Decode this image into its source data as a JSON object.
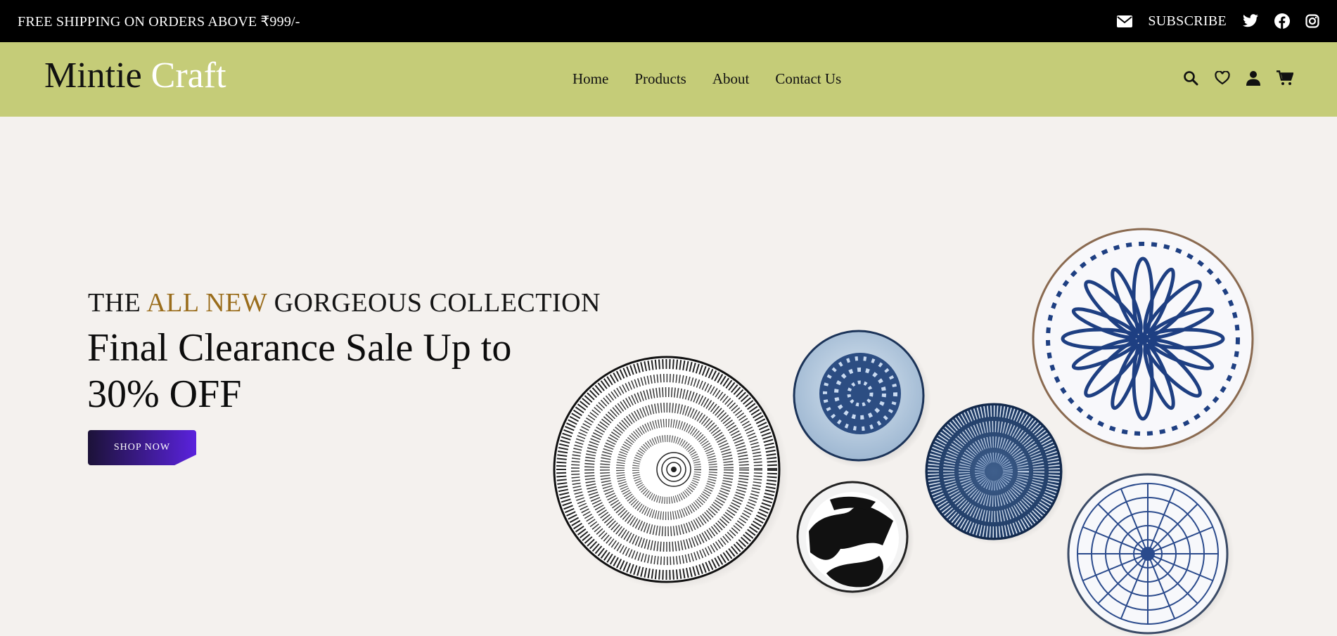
{
  "topbar": {
    "promo": "FREE SHIPPING ON ORDERS ABOVE ₹999/-",
    "subscribe": "SUBSCRIBE",
    "icons": [
      "envelope-icon",
      "twitter-icon",
      "facebook-icon",
      "instagram-icon"
    ]
  },
  "header": {
    "logo_part1": "Mintie",
    "logo_part2": "Craft",
    "nav": [
      "Home",
      "Products",
      "About",
      "Contact Us"
    ],
    "tools": [
      "search-icon",
      "heart-icon",
      "user-icon",
      "cart-icon"
    ]
  },
  "hero": {
    "eyebrow_part1": "THE",
    "eyebrow_highlight": "ALL NEW",
    "eyebrow_part2": "GORGEOUS COLLECTION",
    "headline": "Final Clearance Sale Up to 30% OFF",
    "button": "SHOP NOW"
  },
  "colors": {
    "topbar_bg": "#000000",
    "header_bg": "#c5cc78",
    "hero_bg": "#f4f1ee",
    "highlight": "#9a6d1c",
    "button_gradient_start": "#1c1238",
    "button_gradient_end": "#5a22dd"
  }
}
